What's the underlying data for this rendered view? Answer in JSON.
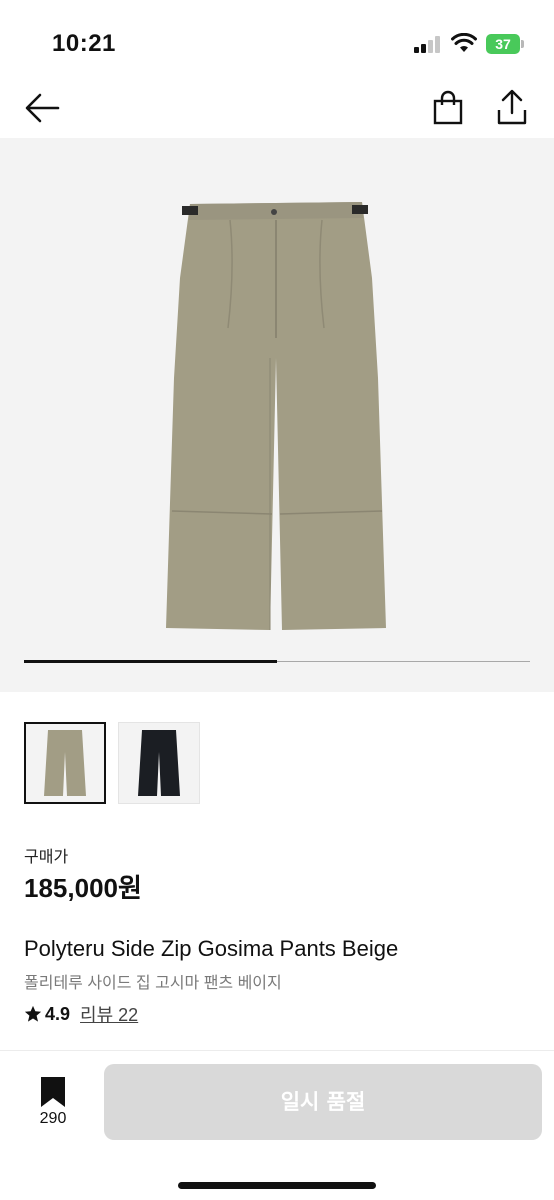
{
  "status_bar": {
    "time": "10:21",
    "battery_level": "37",
    "battery_color": "#49c95a",
    "icons": [
      "signal-icon",
      "wifi-icon",
      "battery-icon"
    ]
  },
  "nav": {
    "icons": [
      "arrow-left-icon",
      "shopping-bag-icon",
      "share-icon"
    ]
  },
  "gallery": {
    "images": [
      {
        "color": "beige",
        "selected": true
      },
      {
        "color": "black",
        "selected": false
      }
    ],
    "progress": 0.5
  },
  "product": {
    "price_label": "구매가",
    "price": "185,000원",
    "name_en": "Polyteru Side Zip Gosima Pants Beige",
    "name_ko": "폴리테루 사이드 집 고시마 팬츠 베이지",
    "rating": "4.9",
    "review_link": "리뷰 22"
  },
  "bottom_bar": {
    "bookmark_count": "290",
    "soldout_label": "일시 품절",
    "soldout_bg": "#d9d9d9"
  },
  "colors": {
    "beige_pants": "#a29d85",
    "black_pants": "#1b1e23",
    "hero_bg": "#f3f3f3"
  }
}
